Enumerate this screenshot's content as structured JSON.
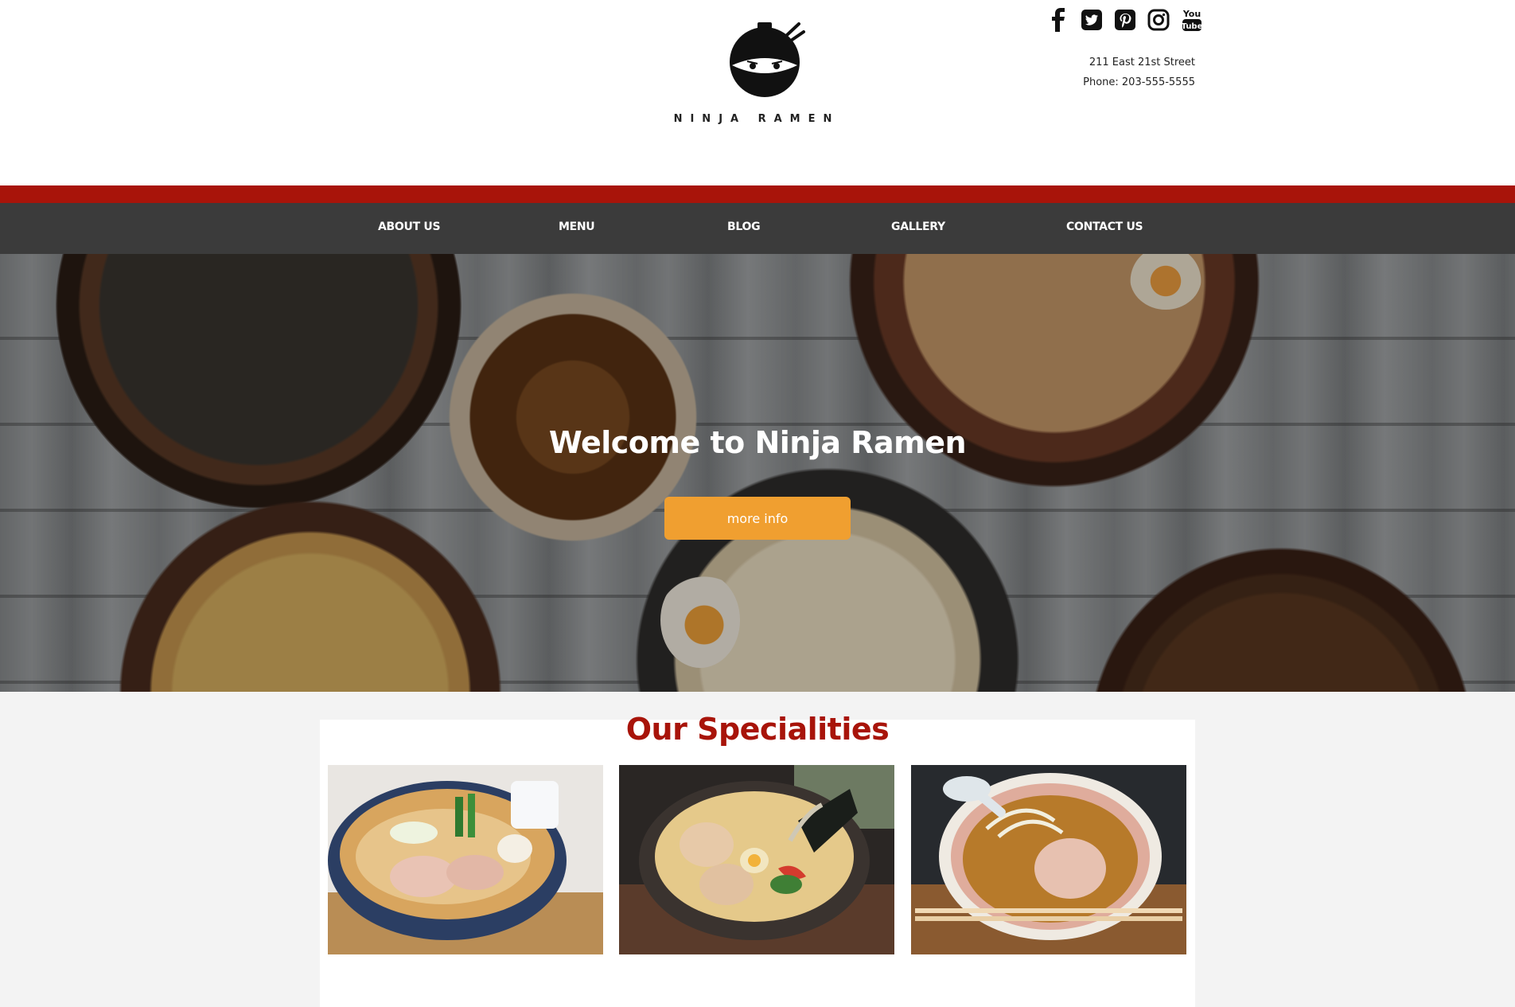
{
  "brand": {
    "name": "NINJA RAMEN",
    "logo_icon": "ninja-ramen-logo-icon"
  },
  "social": [
    {
      "name": "facebook-icon",
      "glyph": "f"
    },
    {
      "name": "twitter-icon",
      "glyph": "t"
    },
    {
      "name": "pinterest-icon",
      "glyph": "p"
    },
    {
      "name": "instagram-icon",
      "glyph": "i"
    },
    {
      "name": "youtube-icon",
      "glyph": "You Tube"
    }
  ],
  "contact": {
    "address": "211 East 21st Street",
    "phone": "Phone: 203-555-5555"
  },
  "nav": {
    "about": "ABOUT US",
    "menu": "MENU",
    "blog": "BLOG",
    "gallery": "GALLERY",
    "contact": "CONTACT US"
  },
  "hero": {
    "title": "Welcome to Ninja Ramen",
    "button": "more info"
  },
  "specialities": {
    "title": "Our Specialities",
    "images": [
      "ramen-photo-1",
      "ramen-photo-2",
      "ramen-photo-3"
    ]
  },
  "colors": {
    "brand_red": "#a8140a",
    "nav_bg": "#3b3b3b",
    "button_orange": "#f09f30",
    "page_bg": "#f3f3f3"
  }
}
